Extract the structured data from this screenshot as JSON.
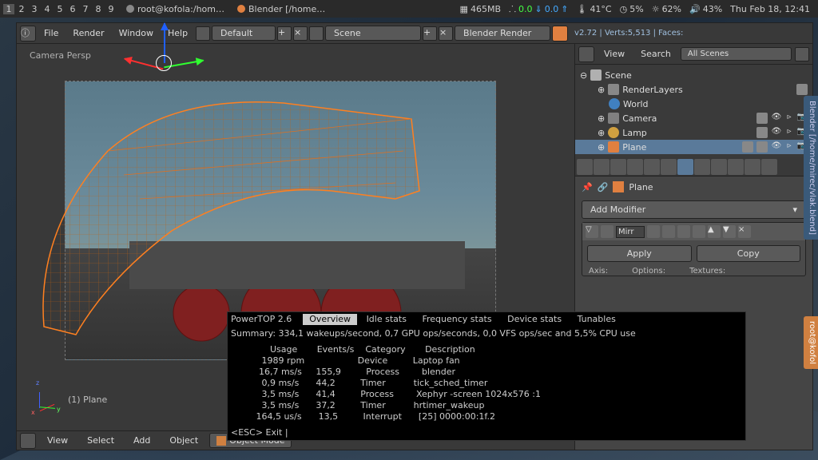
{
  "taskbar": {
    "workspaces": [
      "1",
      "2",
      "3",
      "4",
      "5",
      "6",
      "7",
      "8",
      "9"
    ],
    "active_workspace": 0,
    "tasks": [
      {
        "label": "root@kofola:/hom…"
      },
      {
        "label": "Blender [/home…"
      }
    ],
    "tray": {
      "mem": "465MB",
      "net_down": "0.0",
      "net_up": "0.0",
      "temp": "41°C",
      "cpu": "5%",
      "bright": "62%",
      "vol": "43%",
      "clock": "Thu Feb 18, 12:41"
    }
  },
  "blender": {
    "menu": [
      "File",
      "Render",
      "Window",
      "Help"
    ],
    "layout_dropdown": "Default",
    "scene_dropdown": "Scene",
    "engine_dropdown": "Blender Render",
    "stats": "v2.72 | Verts:5,513 | Faces:",
    "viewport": {
      "persp_label": "Camera Persp",
      "selection_label": "(1) Plane",
      "footer": [
        "View",
        "Select",
        "Add",
        "Object"
      ],
      "mode": "Object Mode"
    },
    "outliner": {
      "header_view": "View",
      "header_search": "Search",
      "filter_label": "All Scenes",
      "tree": [
        {
          "icon": "scene",
          "label": "Scene",
          "indent": 0
        },
        {
          "icon": "renderlayers",
          "label": "RenderLayers",
          "indent": 1
        },
        {
          "icon": "world",
          "label": "World",
          "indent": 1
        },
        {
          "icon": "camera",
          "label": "Camera",
          "indent": 1,
          "ctrls": true
        },
        {
          "icon": "lamp",
          "label": "Lamp",
          "indent": 1,
          "ctrls": true
        },
        {
          "icon": "plane",
          "label": "Plane",
          "indent": 1,
          "ctrls": true,
          "selected": true
        }
      ]
    },
    "props": {
      "breadcrumb": "Plane",
      "add_modifier": "Add Modifier",
      "modifier_name": "Mirr",
      "apply": "Apply",
      "copy": "Copy",
      "labels": [
        "Axis:",
        "Options:",
        "Textures:"
      ]
    },
    "side_tab": "Blender [/home/mirec/vlak.blend]"
  },
  "terminal": {
    "title": "PowerTOP 2.6",
    "tabs": [
      "Overview",
      "Idle stats",
      "Frequency stats",
      "Device stats",
      "Tunables"
    ],
    "active_tab": 0,
    "summary": "Summary: 334,1 wakeups/second,  0,7 GPU ops/seconds, 0,0 VFS ops/sec and 5,5% CPU use",
    "cols": "              Usage       Events/s    Category       Description",
    "rows": [
      "           1989 rpm                   Device         Laptop fan",
      "          16,7 ms/s     155,9         Process        blender",
      "           0,9 ms/s      44,2         Timer          tick_sched_timer",
      "           3,5 ms/s      41,4         Process        Xephyr -screen 1024x576 :1",
      "           3,5 ms/s      37,2         Timer          hrtimer_wakeup",
      "         164,5 us/s      13,5         Interrupt      [25] 0000:00:1f.2"
    ],
    "footer": "<ESC> Exit |",
    "side_label": "root@kofol"
  }
}
